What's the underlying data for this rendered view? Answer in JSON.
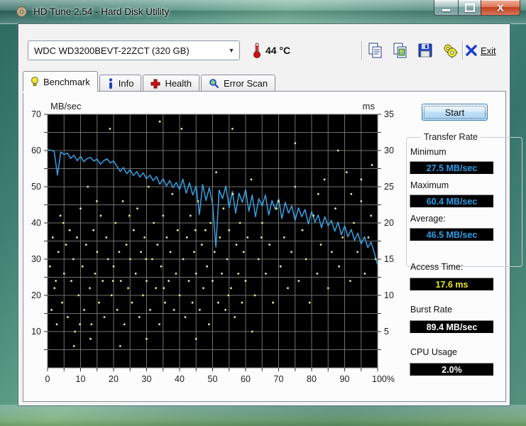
{
  "window": {
    "title": "HD Tune 2.54 - Hard Disk Utility"
  },
  "toolbar": {
    "drive_selector": "WDC WD3200BEVT-22ZCT (320 GB)",
    "temperature": "44 °C",
    "exit_label": "Exit"
  },
  "tabs": [
    {
      "label": "Benchmark",
      "active": true
    },
    {
      "label": "Info",
      "active": false
    },
    {
      "label": "Health",
      "active": false
    },
    {
      "label": "Error Scan",
      "active": false
    }
  ],
  "panel": {
    "start_label": "Start",
    "transfer_rate": {
      "title": "Transfer Rate",
      "minimum_label": "Minimum",
      "minimum_value": "27.5 MB/sec",
      "maximum_label": "Maximum",
      "maximum_value": "60.4 MB/sec",
      "average_label": "Average:",
      "average_value": "46.5 MB/sec"
    },
    "access_time_label": "Access Time:",
    "access_time_value": "17.6 ms",
    "burst_rate_label": "Burst Rate",
    "burst_rate_value": "89.4 MB/sec",
    "cpu_usage_label": "CPU Usage",
    "cpu_usage_value": "2.0%"
  },
  "chart_data": {
    "type": "line+scatter",
    "title": "HD Tune benchmark transfer rate and access time",
    "plot_bg": "#000000",
    "grid_color": "#6f6f6f",
    "grid_step_percent": 5,
    "grid_step_mb": 5,
    "left_axis": {
      "label": "MB/sec",
      "min": 0,
      "max": 70,
      "tick_labels": [
        70,
        60,
        50,
        40,
        30,
        20,
        10
      ]
    },
    "right_axis": {
      "label": "ms",
      "min": 0,
      "max": 35,
      "tick_labels": [
        35,
        30,
        25,
        20,
        15,
        10,
        5
      ]
    },
    "x_axis": {
      "min": 0,
      "max": 100,
      "tick_values": [
        0,
        10,
        20,
        30,
        40,
        50,
        60,
        70,
        80,
        90,
        100
      ],
      "tick_labels": [
        "0",
        "10",
        "20",
        "30",
        "40",
        "50",
        "60",
        "70",
        "80",
        "90",
        "100%"
      ]
    },
    "series": [
      {
        "name": "transfer-rate",
        "type": "line",
        "color": "#35a2e5",
        "x_start": 0,
        "x_step": 1,
        "unit": "MB/sec",
        "y": [
          60.2,
          60.1,
          59.8,
          53.2,
          59.6,
          58.9,
          59.3,
          57.8,
          58.7,
          57.2,
          58.4,
          56.9,
          57.8,
          58.1,
          57.1,
          57.6,
          56.2,
          57.2,
          57.7,
          56.6,
          57.1,
          55.7,
          54.2,
          55.3,
          53.6,
          54.7,
          53.1,
          54.2,
          52.7,
          53.8,
          52.2,
          53.2,
          51.7,
          52.8,
          50.7,
          52.2,
          50.2,
          51.7,
          49.7,
          51.2,
          49.2,
          52.1,
          48.2,
          51.1,
          47.7,
          50.2,
          42.3,
          50.6,
          46.2,
          49.7,
          45.2,
          33.4,
          49.1,
          46.7,
          50.2,
          44.2,
          48.7,
          42.7,
          48.2,
          45.7,
          49.2,
          43.2,
          47.7,
          41.7,
          46.7,
          44.7,
          47.7,
          42.2,
          46.2,
          43.7,
          46.7,
          41.2,
          45.7,
          42.7,
          44.7,
          40.7,
          44.2,
          41.7,
          43.7,
          39.7,
          43.2,
          40.2,
          42.2,
          38.7,
          41.7,
          39.2,
          40.7,
          37.7,
          40.2,
          36.7,
          39.2,
          36.2,
          38.2,
          35.2,
          37.2,
          34.2,
          36.2,
          33.2,
          34.7,
          31.7,
          28.4
        ]
      },
      {
        "name": "access-time",
        "type": "scatter",
        "color": "#eaea90",
        "unit": "ms",
        "points": [
          [
            0.7,
            14
          ],
          [
            1.2,
            8
          ],
          [
            1.6,
            18
          ],
          [
            2.1,
            11
          ],
          [
            2.8,
            6
          ],
          [
            3.3,
            16
          ],
          [
            3.9,
            21
          ],
          [
            4.4,
            9
          ],
          [
            5,
            13
          ],
          [
            5.6,
            17
          ],
          [
            6.1,
            7
          ],
          [
            6.7,
            19
          ],
          [
            7.2,
            12
          ],
          [
            7.8,
            15
          ],
          [
            8.3,
            5
          ],
          [
            8.9,
            18
          ],
          [
            9.4,
            10
          ],
          [
            10,
            22
          ],
          [
            10.6,
            14
          ],
          [
            11.1,
            8
          ],
          [
            11.7,
            17
          ],
          [
            12.2,
            25
          ],
          [
            12.8,
            11
          ],
          [
            13.3,
            6
          ],
          [
            13.9,
            19
          ],
          [
            14.4,
            13
          ],
          [
            15,
            16
          ],
          [
            15.6,
            9
          ],
          [
            16.1,
            21
          ],
          [
            16.7,
            12
          ],
          [
            17.2,
            7
          ],
          [
            17.8,
            18
          ],
          [
            18.3,
            15
          ],
          [
            18.9,
            33
          ],
          [
            19.4,
            10
          ],
          [
            20,
            14
          ],
          [
            20.6,
            20
          ],
          [
            21.1,
            8
          ],
          [
            21.7,
            16
          ],
          [
            22.2,
            12
          ],
          [
            22.8,
            23
          ],
          [
            23.3,
            6
          ],
          [
            23.9,
            17
          ],
          [
            24.4,
            11
          ],
          [
            25,
            15
          ],
          [
            25.6,
            9
          ],
          [
            26.1,
            19
          ],
          [
            26.7,
            13
          ],
          [
            27.2,
            22
          ],
          [
            27.8,
            7
          ],
          [
            28.3,
            16
          ],
          [
            28.9,
            10
          ],
          [
            29.4,
            18
          ],
          [
            30,
            12
          ],
          [
            30.6,
            25
          ],
          [
            31.1,
            8
          ],
          [
            31.7,
            15
          ],
          [
            32.2,
            20
          ],
          [
            32.8,
            11
          ],
          [
            33.3,
            17
          ],
          [
            33.9,
            6
          ],
          [
            34.4,
            14
          ],
          [
            35,
            21
          ],
          [
            35.6,
            9
          ],
          [
            36.1,
            18
          ],
          [
            36.7,
            12
          ],
          [
            37.2,
            16
          ],
          [
            37.8,
            24
          ],
          [
            38.3,
            8
          ],
          [
            38.9,
            13
          ],
          [
            39.4,
            19
          ],
          [
            40,
            10
          ],
          [
            40.6,
            33
          ],
          [
            41.1,
            15
          ],
          [
            41.7,
            7
          ],
          [
            42.2,
            18
          ],
          [
            42.8,
            12
          ],
          [
            43.3,
            21
          ],
          [
            43.9,
            9
          ],
          [
            44.4,
            16
          ],
          [
            45,
            13
          ],
          [
            45.6,
            23
          ],
          [
            46.1,
            8
          ],
          [
            46.7,
            17
          ],
          [
            47.2,
            11
          ],
          [
            47.8,
            19
          ],
          [
            48.3,
            14
          ],
          [
            48.9,
            6
          ],
          [
            49.4,
            20
          ],
          [
            50,
            12
          ],
          [
            50.6,
            16
          ],
          [
            51.1,
            27
          ],
          [
            51.7,
            9
          ],
          [
            52.2,
            18
          ],
          [
            52.8,
            13
          ],
          [
            53.3,
            22
          ],
          [
            53.9,
            8
          ],
          [
            54.4,
            15
          ],
          [
            55,
            19
          ],
          [
            55.6,
            11
          ],
          [
            56.1,
            24
          ],
          [
            56.7,
            7
          ],
          [
            57.2,
            17
          ],
          [
            57.8,
            13
          ],
          [
            58.3,
            20
          ],
          [
            58.9,
            9
          ],
          [
            59.4,
            16
          ],
          [
            60,
            12
          ],
          [
            60.6,
            18
          ],
          [
            61.7,
            26
          ],
          [
            62.8,
            10
          ],
          [
            63.9,
            15
          ],
          [
            65,
            20
          ],
          [
            66.1,
            13
          ],
          [
            67.2,
            17
          ],
          [
            68.3,
            9
          ],
          [
            69.4,
            22
          ],
          [
            70.6,
            14
          ],
          [
            71.7,
            18
          ],
          [
            72.8,
            11
          ],
          [
            73.9,
            16
          ],
          [
            75,
            25
          ],
          [
            76.1,
            12
          ],
          [
            77.2,
            19
          ],
          [
            78.3,
            15
          ],
          [
            79.4,
            9
          ],
          [
            80.6,
            21
          ],
          [
            81.7,
            13
          ],
          [
            82.8,
            17
          ],
          [
            83.9,
            26
          ],
          [
            85,
            11
          ],
          [
            86.1,
            16
          ],
          [
            87.2,
            22
          ],
          [
            88.3,
            14
          ],
          [
            89.4,
            18
          ],
          [
            90.6,
            27
          ],
          [
            91.7,
            12
          ],
          [
            92.8,
            20
          ],
          [
            93.9,
            16
          ],
          [
            95,
            23
          ],
          [
            96.1,
            13
          ],
          [
            97.2,
            18
          ],
          [
            98.3,
            28
          ],
          [
            99.4,
            15
          ],
          [
            34,
            34
          ],
          [
            56,
            33
          ],
          [
            75,
            31
          ],
          [
            88,
            30
          ],
          [
            92,
            24
          ],
          [
            13,
            4
          ],
          [
            22,
            3
          ],
          [
            30,
            4
          ],
          [
            8,
            3
          ],
          [
            45,
            4
          ],
          [
            62,
            5
          ],
          [
            70,
            23
          ],
          [
            82,
            24
          ],
          [
            95,
            26
          ],
          [
            98,
            21
          ],
          [
            2.5,
            12
          ],
          [
            4.8,
            20
          ],
          [
            9.8,
            6
          ],
          [
            14.9,
            23
          ],
          [
            19.8,
            12
          ],
          [
            24.8,
            21
          ],
          [
            29.8,
            15
          ],
          [
            35.2,
            11
          ],
          [
            44.8,
            19
          ],
          [
            54.8,
            10
          ],
          [
            64.8,
            18
          ]
        ]
      }
    ]
  }
}
